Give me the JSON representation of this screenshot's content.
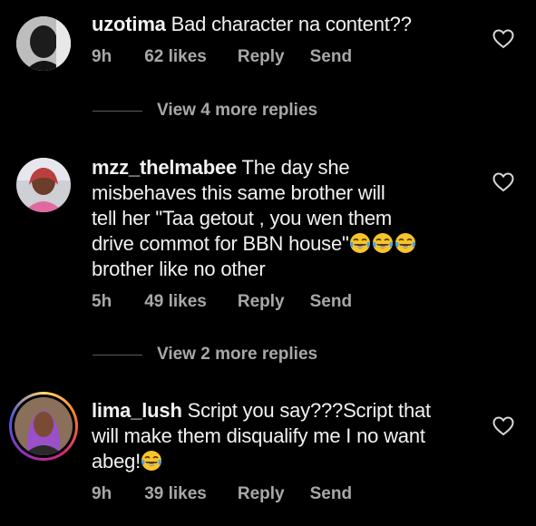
{
  "comments": [
    {
      "username": "uzotima",
      "text": "Bad character na content??",
      "emoji_count": 0,
      "time": "9h",
      "likes": "62 likes",
      "reply": "Reply",
      "send": "Send",
      "view_replies": "View 4 more replies"
    },
    {
      "username": "mzz_thelmabee",
      "text_line1": "The day she",
      "text_line2": "misbehaves  this same brother will",
      "text_line3": "tell her \"Taa getout , you wen them",
      "text_line4": "drive commot for BBN house\"",
      "text_line5": "brother like no other",
      "emoji_count": 3,
      "time": "5h",
      "likes": "49 likes",
      "reply": "Reply",
      "send": "Send",
      "view_replies": "View 2 more replies"
    },
    {
      "username": "lima_lush",
      "text_line1": "Script you say???Script that",
      "text_line2": "will make them disqualify me I no want",
      "text_line3": "abeg!",
      "emoji_count": 1,
      "time": "9h",
      "likes": "39 likes",
      "reply": "Reply",
      "send": "Send"
    }
  ],
  "icons": {
    "like": "heart-outline-icon",
    "emoji": "face-with-tears-of-joy"
  },
  "colors": {
    "background": "#000000",
    "text": "#f2f2f2",
    "meta": "#a8a8a8",
    "emoji": "#f7c52b"
  }
}
